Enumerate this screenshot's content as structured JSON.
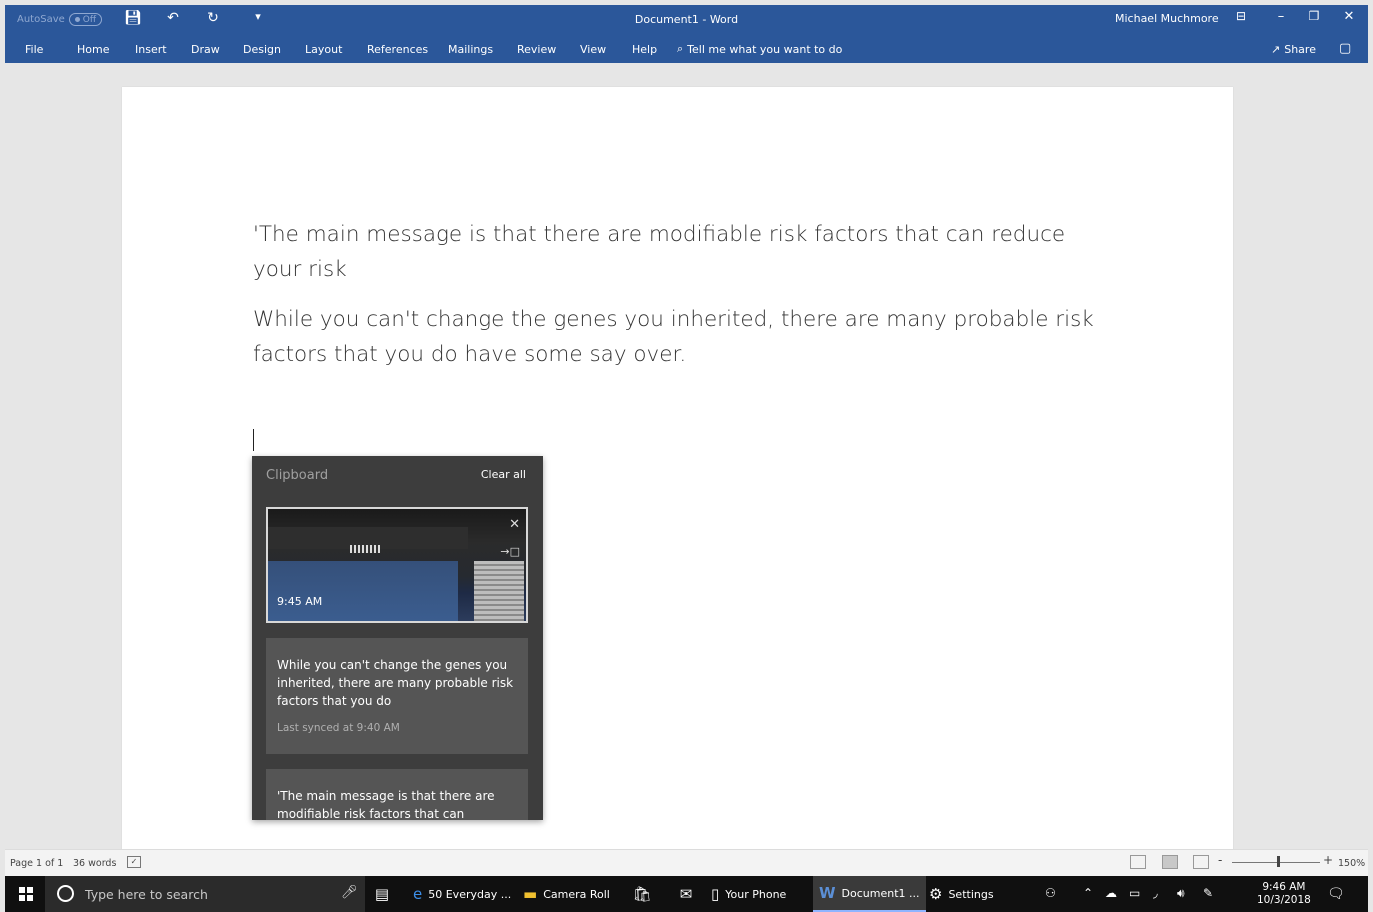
{
  "titlebar": {
    "autosave_label": "AutoSave",
    "autosave_state": "Off",
    "doc_title": "Document1  -  Word",
    "user": "Michael Muchmore"
  },
  "menu": {
    "tabs": [
      "File",
      "Home",
      "Insert",
      "Draw",
      "Design",
      "Layout",
      "References",
      "Mailings",
      "Review",
      "View",
      "Help"
    ],
    "tell_me": "Tell me what you want to do",
    "share": "Share"
  },
  "document": {
    "paragraphs": [
      "'The main message is that there are modifiable risk factors that can reduce your risk",
      "While you can't change the genes you inherited, there are many probable risk factors that you do have some say over."
    ]
  },
  "clipboard": {
    "title": "Clipboard",
    "clear_all": "Clear all",
    "image_item": {
      "time": "9:45 AM"
    },
    "text_items": [
      {
        "body": "While you can't change the genes you inherited, there are many probable risk factors that you do",
        "sync": "Last synced at 9:40 AM"
      },
      {
        "body": "'The main message is that there are modifiable risk factors that can",
        "sync": ""
      }
    ]
  },
  "status": {
    "page": "Page 1 of 1",
    "words": "36 words",
    "zoom_minus": "-",
    "zoom_plus": "+",
    "zoom": "150%"
  },
  "taskbar": {
    "search_placeholder": "Type here to search",
    "items": [
      "50 Everyday ...",
      "Camera Roll",
      "Your Phone",
      "Document1 ...",
      "Settings"
    ],
    "time": "9:46 AM",
    "date": "10/3/2018"
  }
}
